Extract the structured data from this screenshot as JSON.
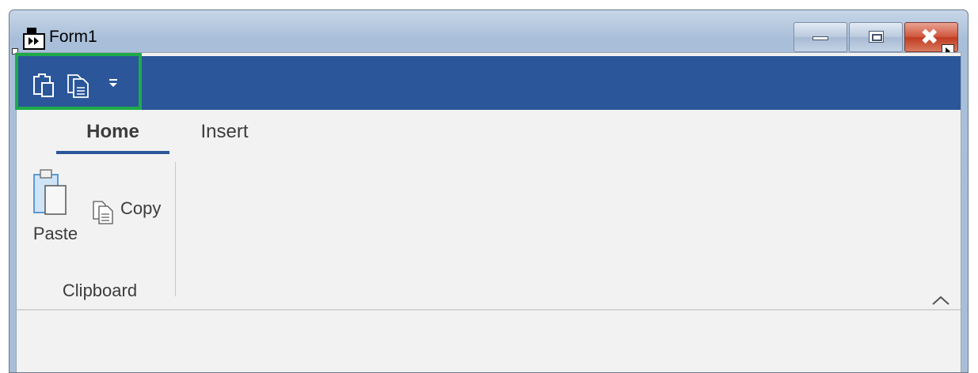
{
  "window": {
    "title": "Form1",
    "icons": {
      "app": "form-designer-icon",
      "minimize": "minimize-icon",
      "maximize": "maximize-icon",
      "close": "close-icon"
    },
    "close_glyph": "✖"
  },
  "quick_access_toolbar": {
    "items": [
      {
        "icon": "paste-icon"
      },
      {
        "icon": "copy-icon"
      },
      {
        "icon": "customize-dropdown-icon"
      }
    ],
    "bar_color": "#2b579a",
    "highlight_color": "#1faa4a"
  },
  "ribbon": {
    "tabs": [
      {
        "label": "Home",
        "selected": true
      },
      {
        "label": "Insert",
        "selected": false
      }
    ],
    "groups": [
      {
        "label": "Clipboard",
        "buttons": [
          {
            "label": "Paste",
            "icon": "paste-icon"
          },
          {
            "label": "Copy",
            "icon": "copy-icon"
          }
        ]
      }
    ],
    "collapse_icon": "chevron-up-icon"
  }
}
